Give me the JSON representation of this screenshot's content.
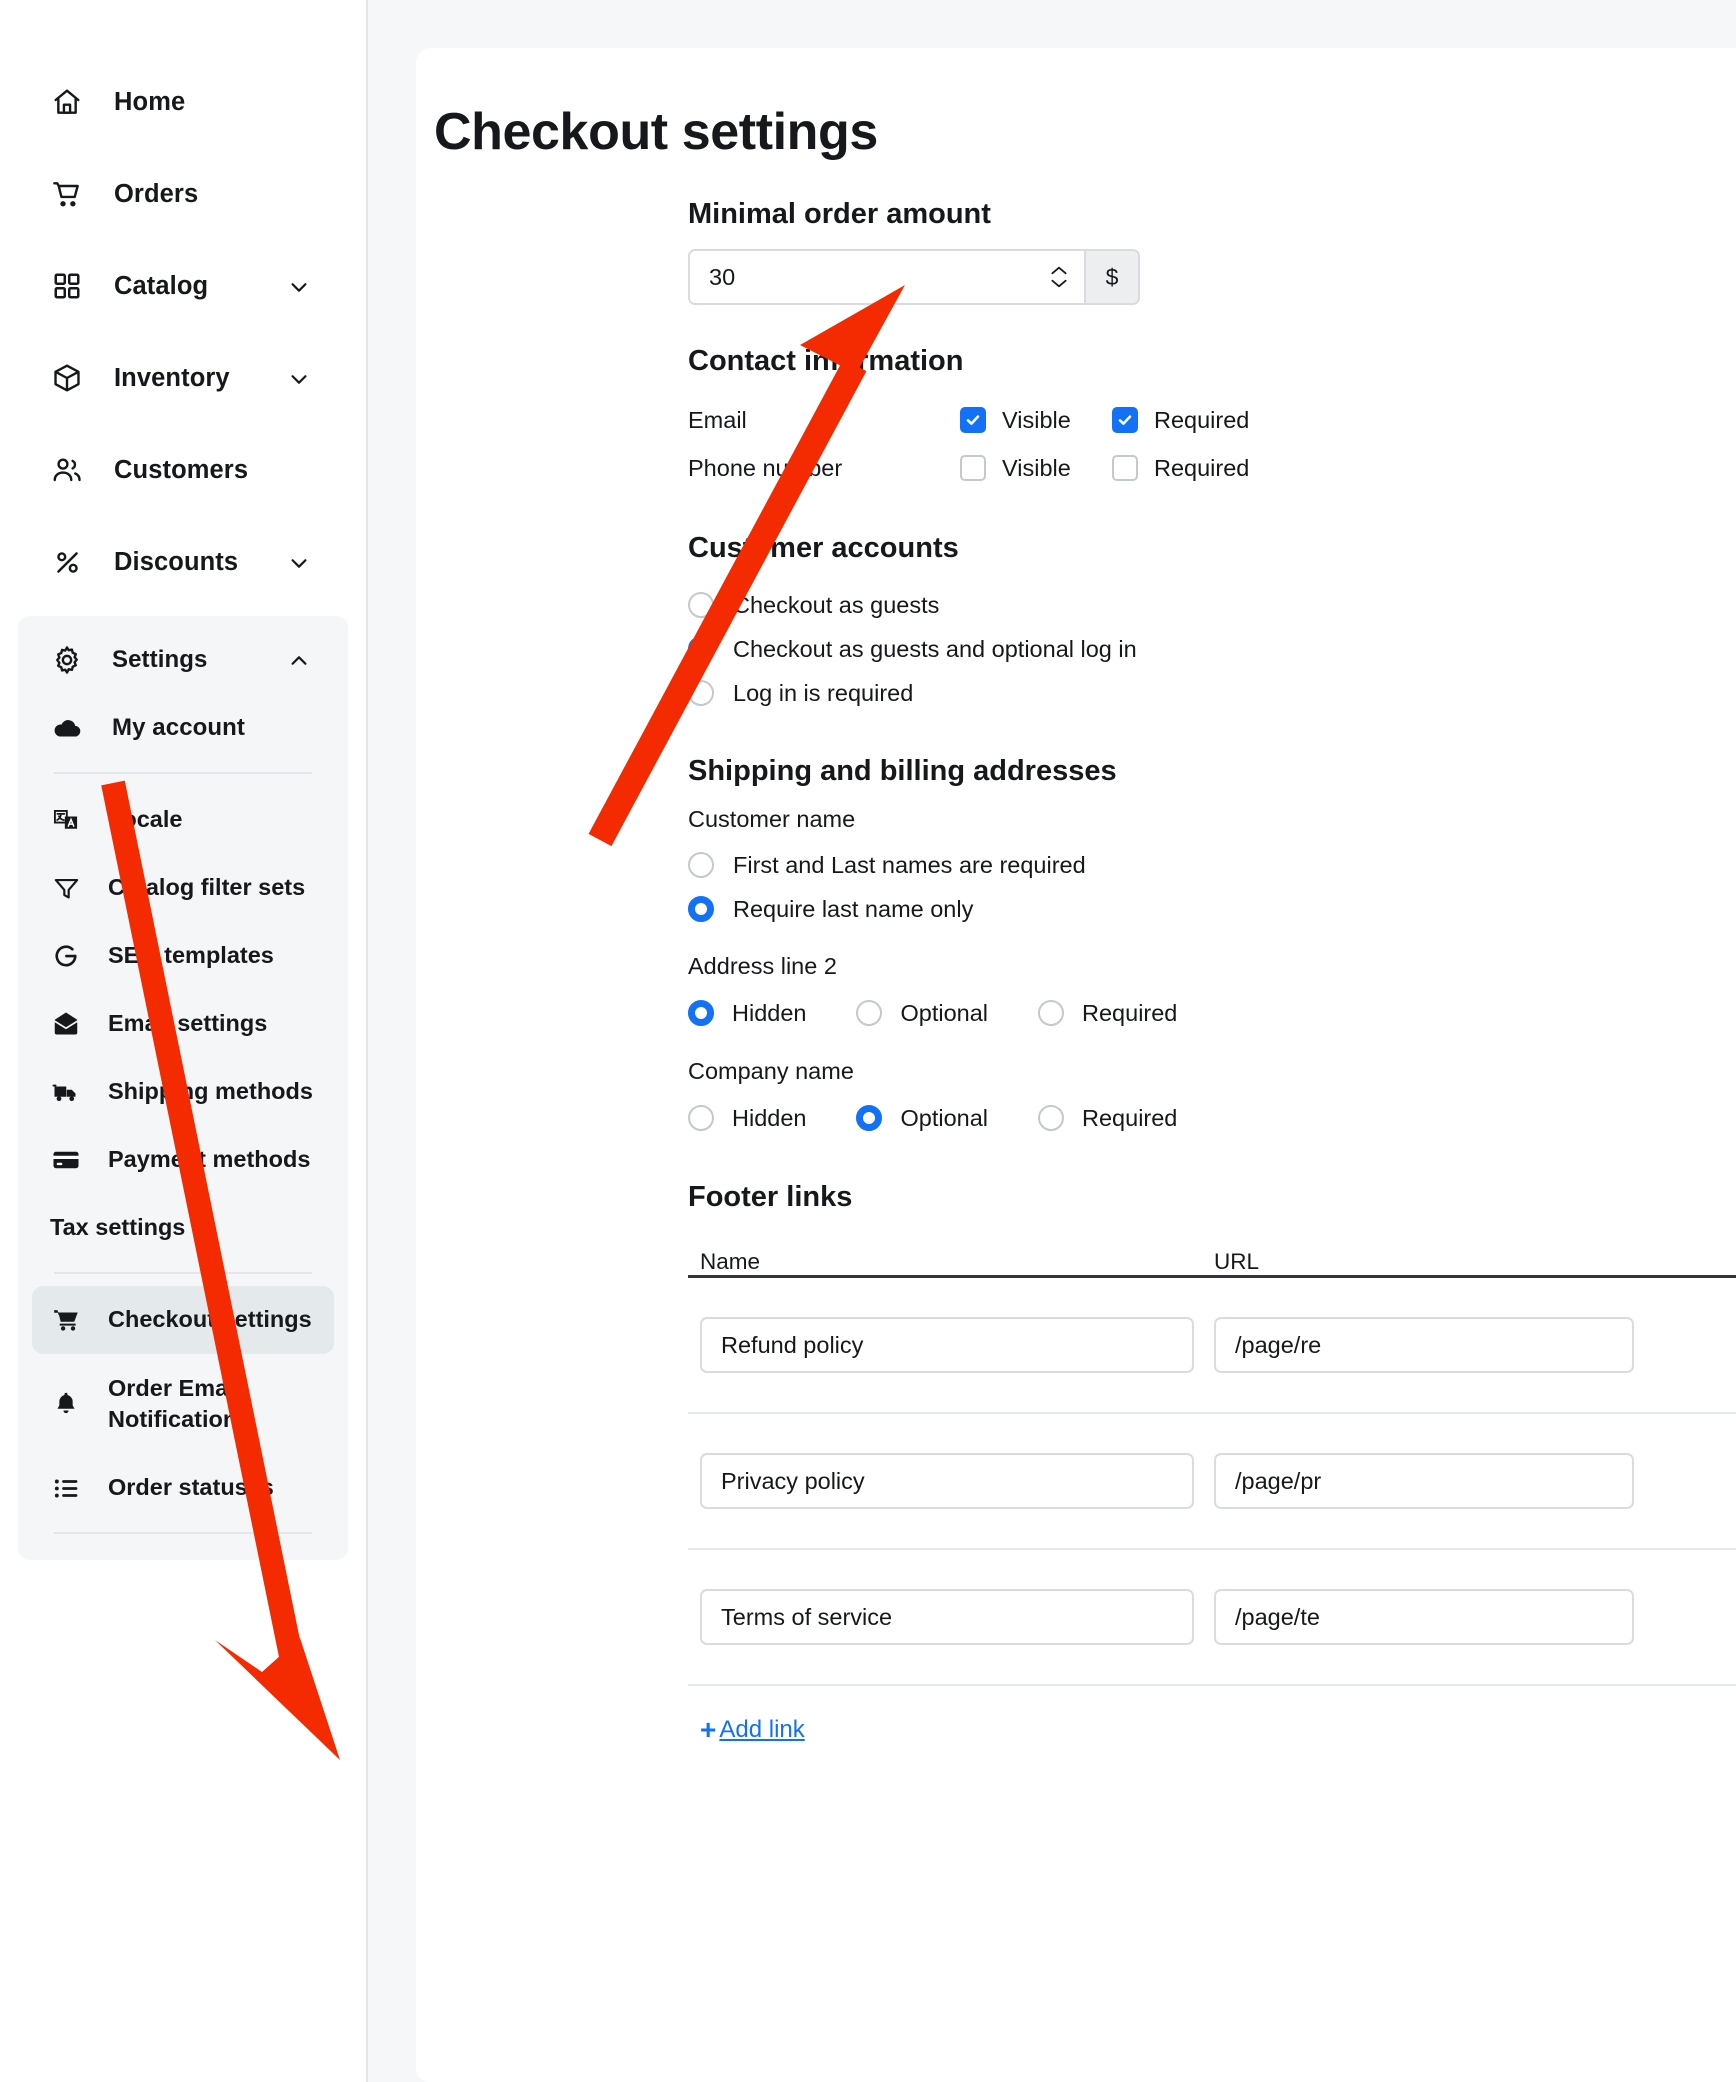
{
  "sidebar": {
    "primary": [
      {
        "label": "Home",
        "icon": "home-icon",
        "chevron": false
      },
      {
        "label": "Orders",
        "icon": "cart-icon",
        "chevron": false
      },
      {
        "label": "Catalog",
        "icon": "grid-icon",
        "chevron": true
      },
      {
        "label": "Inventory",
        "icon": "box-icon",
        "chevron": true
      },
      {
        "label": "Customers",
        "icon": "users-icon",
        "chevron": false
      },
      {
        "label": "Discounts",
        "icon": "percent-icon",
        "chevron": true
      }
    ],
    "settings_group": {
      "header": {
        "label": "Settings",
        "icon": "gear-icon",
        "chevron": true
      },
      "account": {
        "label": "My account",
        "icon": "cloud-icon"
      },
      "items": [
        {
          "label": "Locale",
          "icon": "translate-icon"
        },
        {
          "label": "Catalog filter sets",
          "icon": "funnel-icon"
        },
        {
          "label": "SEO templates",
          "icon": "google-g-icon"
        },
        {
          "label": "Email settings",
          "icon": "envelope-icon"
        },
        {
          "label": "Shipping methods",
          "icon": "truck-icon"
        },
        {
          "label": "Payment methods",
          "icon": "credit-card-icon"
        },
        {
          "label": "Tax settings",
          "icon": "none"
        }
      ],
      "items2": [
        {
          "label": "Checkout settings",
          "icon": "cart-icon",
          "selected": true
        },
        {
          "label": "Order Email Notifications",
          "icon": "bell-icon",
          "selected": false
        },
        {
          "label": "Order statuses",
          "icon": "list-icon",
          "selected": false
        }
      ]
    }
  },
  "page": {
    "title": "Checkout settings"
  },
  "minimal_order": {
    "heading": "Minimal order amount",
    "value": "30",
    "currency_suffix": "$"
  },
  "contact_information": {
    "heading": "Contact information",
    "col_visible": "Visible",
    "col_required": "Required",
    "rows": [
      {
        "name": "Email",
        "visible": true,
        "required": true
      },
      {
        "name": "Phone number",
        "visible": false,
        "required": false
      }
    ]
  },
  "customer_accounts": {
    "heading": "Customer accounts",
    "options": [
      {
        "label": "Checkout as guests",
        "selected": false
      },
      {
        "label": "Checkout as guests and optional log in",
        "selected": true
      },
      {
        "label": "Log in is required",
        "selected": false
      }
    ]
  },
  "shipping_billing": {
    "heading": "Shipping and billing addresses",
    "customer_name": {
      "label": "Customer name",
      "options": [
        {
          "label": "First and Last names are required",
          "selected": false
        },
        {
          "label": "Require last name only",
          "selected": true
        }
      ]
    },
    "address_line_2": {
      "label": "Address line 2",
      "options": [
        {
          "label": "Hidden",
          "selected": true
        },
        {
          "label": "Optional",
          "selected": false
        },
        {
          "label": "Required",
          "selected": false
        }
      ]
    },
    "company_name": {
      "label": "Company name",
      "options": [
        {
          "label": "Hidden",
          "selected": false
        },
        {
          "label": "Optional",
          "selected": true
        },
        {
          "label": "Required",
          "selected": false
        }
      ]
    }
  },
  "footer_links": {
    "heading": "Footer links",
    "columns": {
      "name": "Name",
      "url": "URL"
    },
    "rows": [
      {
        "name": "Refund policy",
        "url": "/page/re"
      },
      {
        "name": "Privacy policy",
        "url": "/page/pr"
      },
      {
        "name": "Terms of service",
        "url": "/page/te"
      }
    ],
    "add_link": {
      "plus": "+",
      "label": "Add link"
    }
  },
  "colors": {
    "accent_blue": "#1271f5",
    "annotation_red": "#f42a00",
    "selected_nav_bg": "#e4e9ec",
    "settings_panel_bg": "#f4f6f7",
    "page_bg": "#f6f7f8"
  }
}
